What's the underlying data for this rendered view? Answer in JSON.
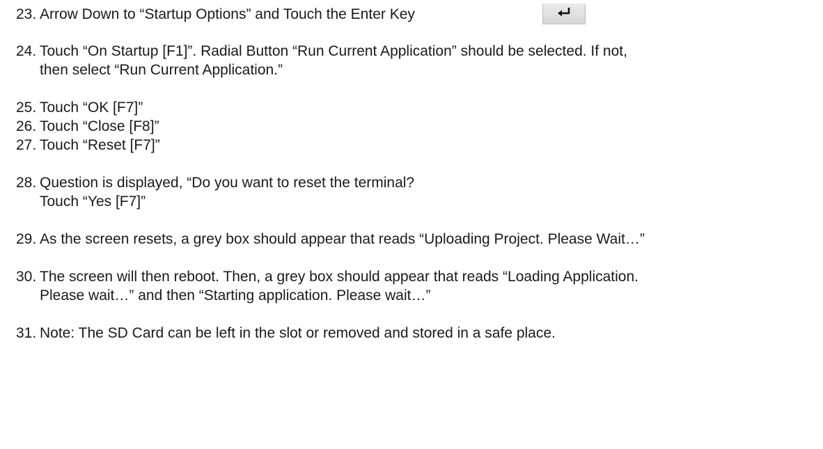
{
  "steps": [
    {
      "num": "23.",
      "lines": [
        "Arrow Down to “Startup Options” and Touch the Enter Key"
      ],
      "icon": "enter-key-icon"
    },
    {
      "num": "24.",
      "lines": [
        "Touch “On Startup [F1]”.  Radial Button “Run Current Application” should be selected. If not,",
        "then select “Run Current Application.”"
      ]
    },
    {
      "num": "25.",
      "lines": [
        "Touch “OK [F7]”"
      ]
    },
    {
      "num": "26.",
      "lines": [
        "Touch “Close [F8]”"
      ]
    },
    {
      "num": "27.",
      "lines": [
        "Touch “Reset [F7]”"
      ]
    },
    {
      "num": "28.",
      "lines": [
        "Question is displayed, “Do you want to reset the terminal?",
        "Touch “Yes [F7]”"
      ]
    },
    {
      "num": "29.",
      "lines": [
        "As the screen resets, a grey box should appear that reads “Uploading Project. Please Wait…”"
      ]
    },
    {
      "num": "30.",
      "lines": [
        "The screen will then reboot.   Then, a grey box should appear that reads “Loading Application.",
        "Please wait…” and then “Starting application.  Please wait…”"
      ]
    },
    {
      "num": "31.",
      "lines": [
        "Note:  The SD Card can be left in the slot or removed and stored in a safe place."
      ]
    }
  ]
}
